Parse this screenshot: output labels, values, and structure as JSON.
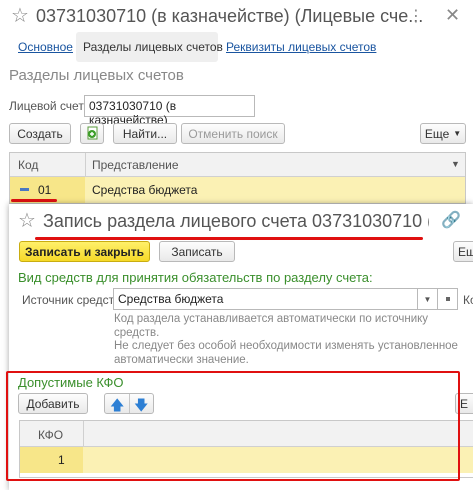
{
  "main": {
    "title": "03731030710 (в казначействе) (Лицевые сче...",
    "tabs": [
      "Основное",
      "Разделы лицевых счетов",
      "Реквизиты лицевых счетов"
    ],
    "section_title": "Разделы лицевых счетов",
    "account_label": "Лицевой счет:",
    "account_value": "03731030710 (в казначействе)",
    "toolbar": {
      "create": "Создать",
      "find": "Найти...",
      "cancel_search": "Отменить поиск",
      "more": "Еще"
    },
    "table": {
      "columns": [
        "Код",
        "Представление"
      ],
      "rows": [
        {
          "code": "01",
          "name": "Средства бюджета"
        }
      ]
    }
  },
  "dialog": {
    "title": "Запись раздела лицевого счета 03731030710 (в к...",
    "save_close": "Записать и закрыть",
    "save": "Записать",
    "more": "Ещ",
    "funds_header": "Вид средств для принятия обязательств по разделу счета:",
    "source_label": "Источник средств:",
    "source_value": "Средства бюджета",
    "source_right_label": "Ко",
    "hint": [
      "Код раздела устанавливается автоматически по источнику",
      "средств.",
      "Не следует без особой необходимости изменять установленное",
      "автоматически значение."
    ],
    "kfo_header": "Допустимые КФО",
    "add": "Добавить",
    "right_cut": "Е",
    "kfo_table": {
      "column": "КФО",
      "rows": [
        {
          "value": "1"
        }
      ]
    }
  },
  "colors": {
    "accent_green": "#3a8f2c",
    "link_blue": "#1a55a0",
    "selection_yellow": "#fbf1b4",
    "annotation_red": "#e01010"
  }
}
